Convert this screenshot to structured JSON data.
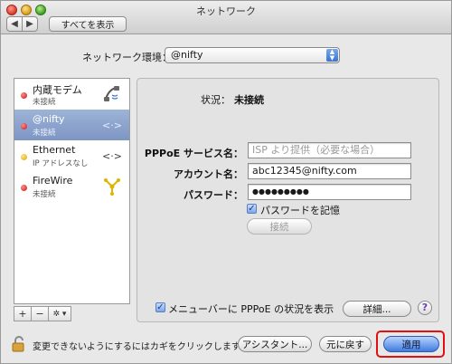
{
  "window": {
    "title": "ネットワーク"
  },
  "toolbar": {
    "back_glyph": "◀",
    "forward_glyph": "▶",
    "show_all_label": "すべてを表示"
  },
  "location": {
    "label": "ネットワーク環境：",
    "value": "@nifty"
  },
  "services": [
    {
      "name": "内蔵モデム",
      "status": "未接続",
      "dot": "red",
      "icon": "modem-icon"
    },
    {
      "name": "@nifty",
      "status": "未接続",
      "dot": "red",
      "icon": "vpn-icon",
      "selected": true
    },
    {
      "name": "Ethernet",
      "status": "IP アドレスなし",
      "dot": "yellow",
      "icon": "ethernet-icon"
    },
    {
      "name": "FireWire",
      "status": "未接続",
      "dot": "red",
      "icon": "firewire-icon"
    }
  ],
  "sidebar_controls": {
    "add": "+",
    "remove": "−",
    "action": "✲ ▾"
  },
  "detail": {
    "status_label": "状況：",
    "status_value": "未接続",
    "service_name_label": "PPPoE サービス名：",
    "service_name_placeholder": "ISP より提供（必要な場合）",
    "account_label": "アカウント名：",
    "account_value": "abc12345@nifty.com",
    "password_label": "パスワード：",
    "password_value": "●●●●●●●●●",
    "remember_password_label": "パスワードを記憶",
    "remember_password_checked": true,
    "connect_label": "接続",
    "menubar_label": "メニューバーに PPPoE の状況を表示",
    "menubar_checked": true,
    "advanced_label": "詳細...",
    "help_label": "?"
  },
  "footer": {
    "lock_text": "変更できないようにするにはカギをクリックします。",
    "assistant_label": "アシスタント...",
    "revert_label": "元に戻す",
    "apply_label": "適用"
  },
  "colors": {
    "selection": "#8aa2cc",
    "apply": "#3f7be0",
    "highlight_ring": "#e21010"
  }
}
